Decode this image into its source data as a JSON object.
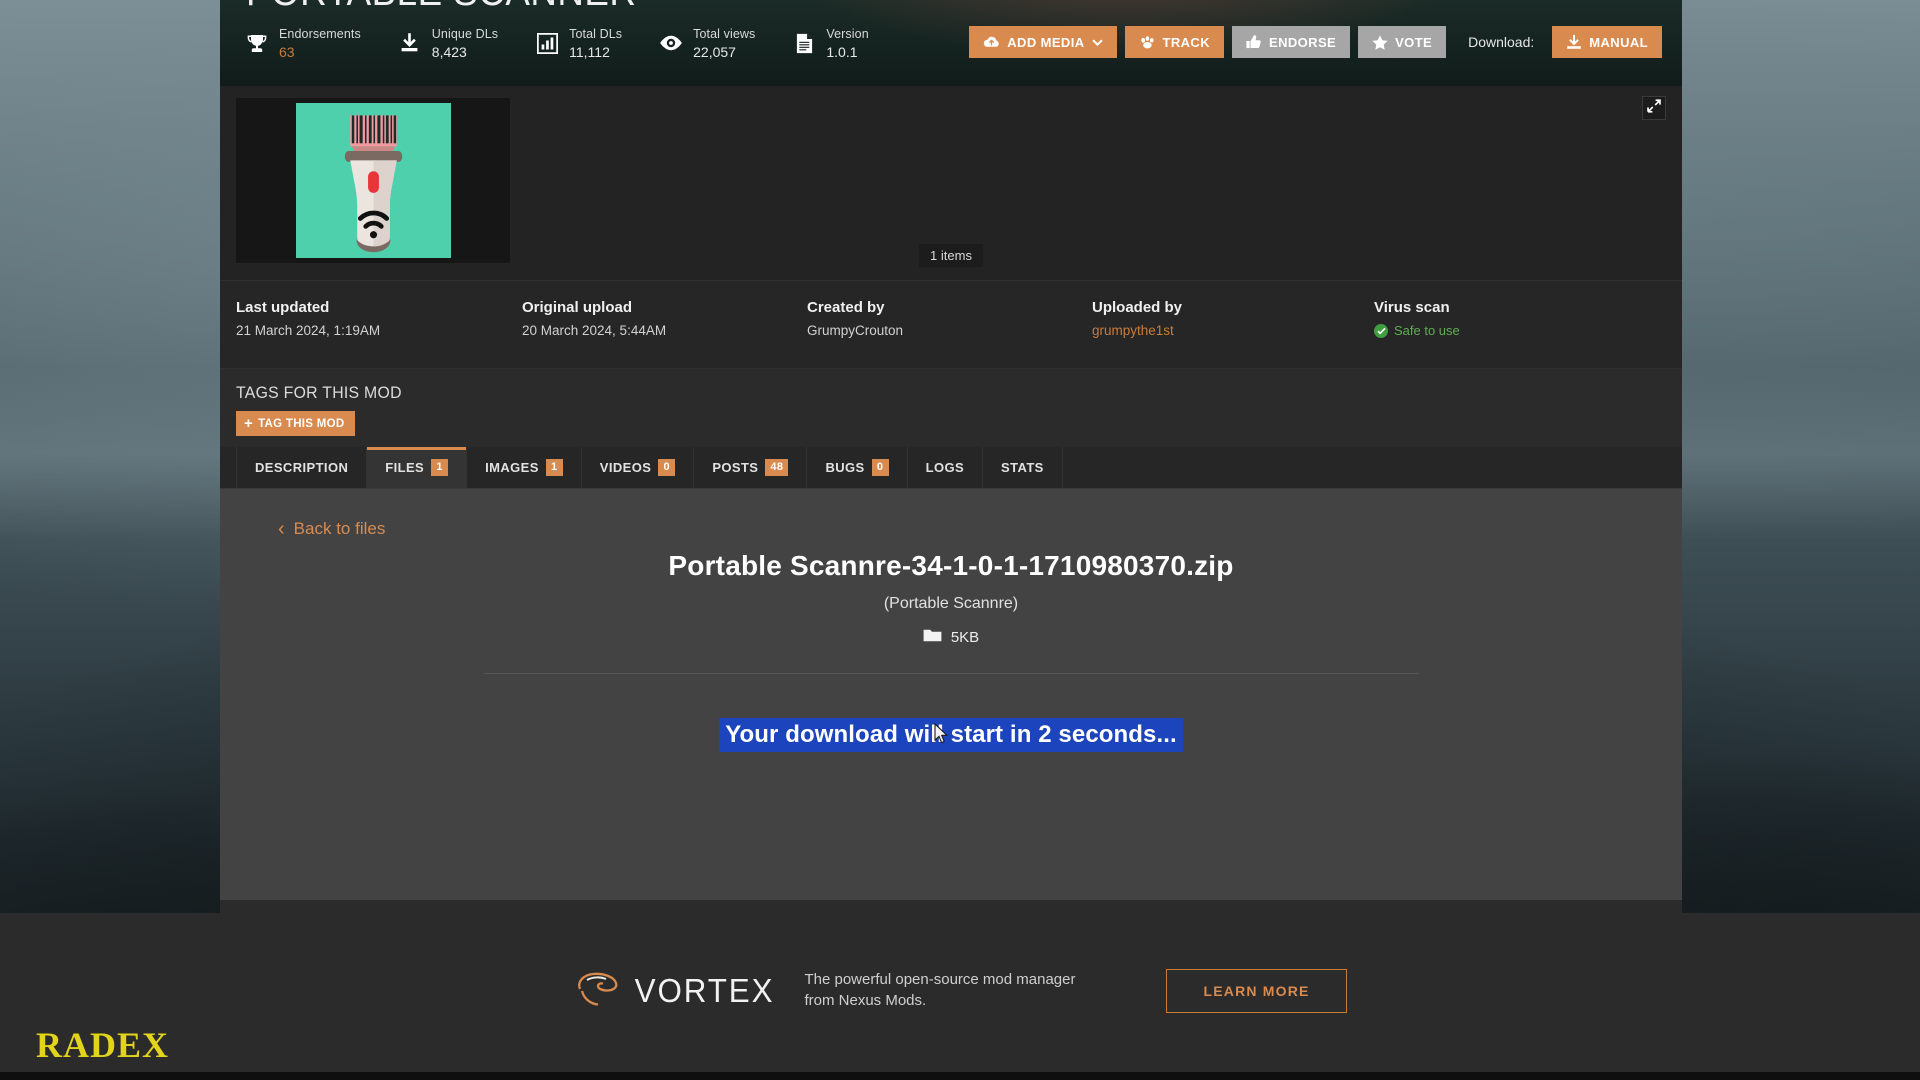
{
  "header": {
    "mod_title": "PORTABLE SCANNER",
    "stats": [
      {
        "icon": "trophy-icon",
        "label": "Endorsements",
        "value": "63"
      },
      {
        "icon": "download-icon",
        "label": "Unique DLs",
        "value": "8,423"
      },
      {
        "icon": "bar-chart-icon",
        "label": "Total DLs",
        "value": "11,112"
      },
      {
        "icon": "eye-icon",
        "label": "Total views",
        "value": "22,057"
      },
      {
        "icon": "document-icon",
        "label": "Version",
        "value": "1.0.1"
      }
    ],
    "actions": {
      "add_media": "ADD MEDIA",
      "track": "TRACK",
      "endorse": "ENDORSE",
      "vote": "VOTE",
      "download_label": "Download:",
      "manual": "MANUAL"
    },
    "colors": {
      "orange": "#d98a4e",
      "grey": "#a6a6a6"
    }
  },
  "gallery": {
    "items_badge": "1 items",
    "expand_icon": "expand-icon"
  },
  "meta": [
    {
      "key": "Last updated",
      "value": "21 March 2024, 1:19AM",
      "link": false
    },
    {
      "key": "Original upload",
      "value": "20 March 2024,  5:44AM",
      "link": false
    },
    {
      "key": "Created by",
      "value": "GrumpyCrouton",
      "link": false
    },
    {
      "key": "Uploaded by",
      "value": "grumpythe1st",
      "link": true
    }
  ],
  "virus_scan": {
    "key": "Virus scan",
    "status": "Safe to use",
    "color": "#63ab55"
  },
  "tags": {
    "heading": "TAGS FOR THIS MOD",
    "button": "TAG THIS MOD"
  },
  "tabs": [
    {
      "label": "DESCRIPTION",
      "count": null,
      "active": false
    },
    {
      "label": "FILES",
      "count": "1",
      "active": true
    },
    {
      "label": "IMAGES",
      "count": "1",
      "active": false
    },
    {
      "label": "VIDEOS",
      "count": "0",
      "active": false
    },
    {
      "label": "POSTS",
      "count": "48",
      "active": false
    },
    {
      "label": "BUGS",
      "count": "0",
      "active": false
    },
    {
      "label": "LOGS",
      "count": null,
      "active": false
    },
    {
      "label": "STATS",
      "count": null,
      "active": false
    }
  ],
  "file_panel": {
    "back_link": "Back to files",
    "file_name": "Portable Scannre-34-1-0-1-1710980370.zip",
    "file_alias": "(Portable Scannre)",
    "file_size": "5KB",
    "countdown_message": "Your download will start in 2 seconds...",
    "highlight_color": "#1c44bd"
  },
  "vortex_banner": {
    "name": "VORTEX",
    "description": "The powerful open-source mod manager from Nexus Mods.",
    "cta": "LEARN MORE",
    "accent": "#d98a4e"
  },
  "watermark": {
    "text": "RADEX",
    "color": "#e2d31b"
  }
}
